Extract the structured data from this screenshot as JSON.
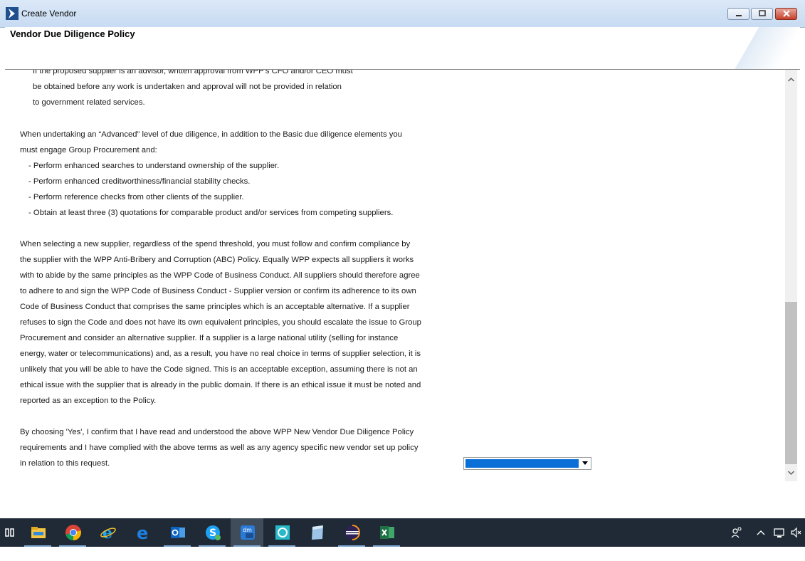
{
  "window": {
    "title": "Create Vendor",
    "page_title": "Vendor Due Diligence Policy"
  },
  "policy": {
    "partial_line": "If the proposed supplier is an advisor, written approval from WPP's CFO and/or CEO must",
    "advisor_lines": [
      "be obtained before any work is undertaken and approval will not be provided in relation",
      "to government related services."
    ],
    "advanced_intro": [
      "When undertaking an “Advanced” level of due diligence, in addition to the Basic due diligence elements you",
      "must engage Group Procurement and:"
    ],
    "advanced_bullets": [
      "- Perform enhanced searches to understand ownership of the supplier.",
      "- Perform enhanced creditworthiness/financial stability checks.",
      "- Perform reference checks from other clients of the supplier.",
      "- Obtain at least three (3) quotations for comparable product and/or services from competing suppliers."
    ],
    "abc_paragraph": [
      "When selecting a new supplier, regardless of the spend threshold, you must follow and confirm compliance by",
      "the supplier with the WPP Anti-Bribery and Corruption (ABC) Policy. Equally WPP expects all suppliers it works",
      "with to abide by the same principles as the WPP Code of Business Conduct. All suppliers should therefore agree",
      "to adhere to and sign the WPP Code of Business Conduct - Supplier version or confirm its adherence to its own",
      "Code of Business Conduct that comprises the same principles which is an acceptable alternative. If a supplier",
      "refuses to sign the Code and does not have its own equivalent principles, you should escalate the issue to Group",
      "Procurement and consider an alternative supplier. If a supplier is a large national utility (selling for instance",
      "energy, water or telecommunications) and, as a result, you have no real choice in terms of supplier selection, it is",
      "unlikely that you will be able to have the Code signed. This is an acceptable exception, assuming there is not an",
      "ethical issue with the supplier that is already in the public domain. If there is an ethical issue it must be noted and",
      "reported as an exception to the Policy."
    ],
    "confirm_paragraph": [
      "By choosing 'Yes', I confirm that I have read and understood the above WPP New Vendor Due Diligence Policy",
      "requirements and I have complied with the above terms as well as any agency specific new vendor set up policy",
      "in relation to this request."
    ]
  },
  "confirmation_select": {
    "value": ""
  },
  "colors": {
    "selection": "#0a70d8",
    "taskbar": "#1f2a36"
  },
  "taskbar": {
    "apps": [
      "task-view-icon",
      "file-explorer-icon",
      "chrome-icon",
      "internet-explorer-icon",
      "edge-icon",
      "outlook-icon",
      "skype-icon",
      "dm-app-icon",
      "sync-app-icon",
      "notes-app-icon",
      "eclipse-icon",
      "excel-icon"
    ]
  }
}
